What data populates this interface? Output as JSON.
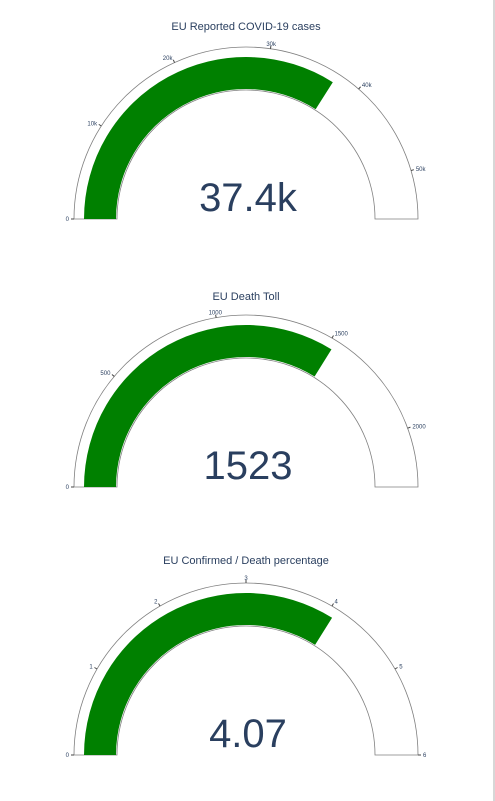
{
  "colors": {
    "bar": "#008000",
    "outline": "#808080",
    "text": "#2a3f5f"
  },
  "chart_data": [
    {
      "type": "gauge",
      "title": "EU Reported COVID-19 cases",
      "value": 37400,
      "value_label": "37.4k",
      "range": [
        0,
        55000
      ],
      "ticks": [
        {
          "value": 0,
          "label": "0"
        },
        {
          "value": 10000,
          "label": "10k"
        },
        {
          "value": 20000,
          "label": "20k"
        },
        {
          "value": 30000,
          "label": "30k"
        },
        {
          "value": 40000,
          "label": "40k"
        },
        {
          "value": 50000,
          "label": "50k"
        }
      ]
    },
    {
      "type": "gauge",
      "title": "EU Death Toll",
      "value": 1523,
      "value_label": "1523",
      "range": [
        0,
        2250
      ],
      "ticks": [
        {
          "value": 0,
          "label": "0"
        },
        {
          "value": 500,
          "label": "500"
        },
        {
          "value": 1000,
          "label": "1000"
        },
        {
          "value": 1500,
          "label": "1500"
        },
        {
          "value": 2000,
          "label": "2000"
        }
      ]
    },
    {
      "type": "gauge",
      "title": "EU Confirmed / Death percentage",
      "value": 4.07,
      "value_label": "4.07",
      "range": [
        0,
        6
      ],
      "ticks": [
        {
          "value": 0,
          "label": "0"
        },
        {
          "value": 1,
          "label": "1"
        },
        {
          "value": 2,
          "label": "2"
        },
        {
          "value": 3,
          "label": "3"
        },
        {
          "value": 4,
          "label": "4"
        },
        {
          "value": 5,
          "label": "5"
        },
        {
          "value": 6,
          "label": "6"
        }
      ]
    }
  ]
}
